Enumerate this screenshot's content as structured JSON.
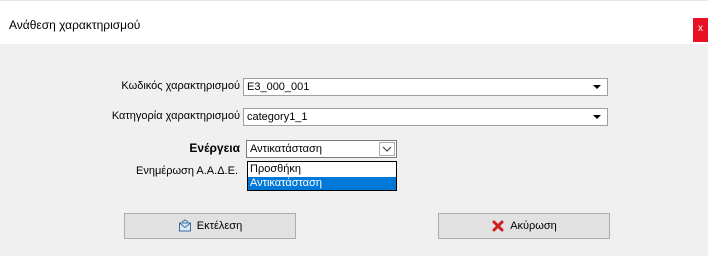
{
  "window": {
    "title": "Ανάθεση χαρακτηρισμού",
    "close_label": "x"
  },
  "form": {
    "code_label": "Κωδικός χαρακτηρισμού",
    "code_value": "E3_000_001",
    "category_label": "Κατηγορία χαρακτηρισμού",
    "category_value": "category1_1",
    "action_label": "Ενέργεια",
    "action_value": "Αντικατάσταση",
    "update_label": "Ενημέρωση Α.Α.Δ.Ε."
  },
  "action_options": [
    "Προσθήκη",
    "Αντικατάσταση"
  ],
  "buttons": {
    "execute_label": "Εκτέλεση",
    "cancel_label": "Ακύρωση"
  },
  "colors": {
    "selection": "#0078d7",
    "close": "#e81123",
    "cancel_icon": "#d11c1c"
  },
  "icons": {
    "execute": "execute-envelope-icon",
    "cancel": "cancel-x-icon",
    "dropdown": "chevron-down-icon"
  }
}
